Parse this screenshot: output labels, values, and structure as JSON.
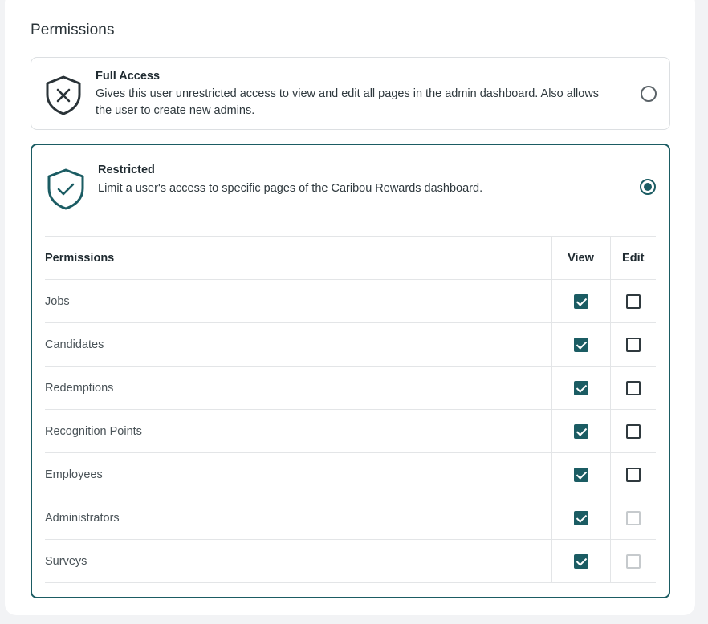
{
  "section": {
    "title": "Permissions"
  },
  "colors": {
    "accent": "#1b5c63",
    "border": "#dcdfe2"
  },
  "options": {
    "full_access": {
      "title": "Full Access",
      "description": "Gives this user unrestricted access to view and edit all pages in the admin dashboard. Also allows the user to create new admins.",
      "icon": "shield-x-icon",
      "selected": false
    },
    "restricted": {
      "title": "Restricted",
      "description": "Limit a user's access to specific pages of the Caribou Rewards dashboard.",
      "icon": "shield-check-icon",
      "selected": true
    }
  },
  "table": {
    "headers": {
      "permissions": "Permissions",
      "view": "View",
      "edit": "Edit"
    },
    "rows": [
      {
        "name": "Jobs",
        "view": "checked",
        "edit": "unchecked"
      },
      {
        "name": "Candidates",
        "view": "checked",
        "edit": "unchecked"
      },
      {
        "name": "Redemptions",
        "view": "checked",
        "edit": "unchecked"
      },
      {
        "name": "Recognition Points",
        "view": "checked",
        "edit": "unchecked"
      },
      {
        "name": "Employees",
        "view": "checked",
        "edit": "unchecked"
      },
      {
        "name": "Administrators",
        "view": "checked",
        "edit": "disabled"
      },
      {
        "name": "Surveys",
        "view": "checked",
        "edit": "disabled"
      }
    ]
  }
}
